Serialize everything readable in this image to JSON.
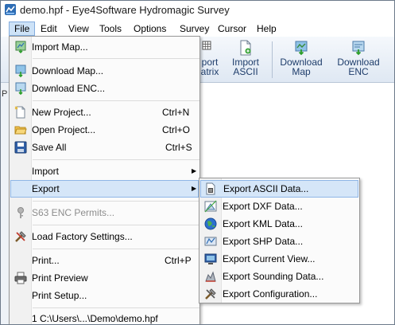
{
  "window": {
    "title": "demo.hpf - Eye4Software Hydromagic Survey"
  },
  "menubar": {
    "items": [
      "File",
      "Edit",
      "View",
      "Tools",
      "Options",
      "Survey",
      "Cursor",
      "Help"
    ]
  },
  "toolbar": {
    "buttons": [
      {
        "line1": "port",
        "line2": "atrix"
      },
      {
        "line1": "Import",
        "line2": "ASCII"
      },
      {
        "line1": "Download",
        "line2": "Map"
      },
      {
        "line1": "Download",
        "line2": "ENC"
      }
    ]
  },
  "left_panel": {
    "tab": "P"
  },
  "file_menu": {
    "items": [
      {
        "label": "Import Map...",
        "shortcut": "",
        "icon": "import-map-icon"
      },
      {
        "label": "Download Map...",
        "shortcut": "",
        "icon": "download-map-icon"
      },
      {
        "label": "Download ENC...",
        "shortcut": "",
        "icon": "download-enc-icon"
      },
      {
        "label": "New Project...",
        "shortcut": "Ctrl+N",
        "icon": "new-project-icon"
      },
      {
        "label": "Open Project...",
        "shortcut": "Ctrl+O",
        "icon": "open-folder-icon"
      },
      {
        "label": "Save All",
        "shortcut": "Ctrl+S",
        "icon": "save-disk-icon"
      },
      {
        "label": "Import",
        "shortcut": "",
        "icon": ""
      },
      {
        "label": "Export",
        "shortcut": "",
        "icon": ""
      },
      {
        "label": "S63 ENC Permits...",
        "shortcut": "",
        "icon": "key-icon"
      },
      {
        "label": "Load Factory Settings...",
        "shortcut": "",
        "icon": "tools-icon"
      },
      {
        "label": "Print...",
        "shortcut": "Ctrl+P",
        "icon": ""
      },
      {
        "label": "Print Preview",
        "shortcut": "",
        "icon": "printer-icon"
      },
      {
        "label": "Print Setup...",
        "shortcut": "",
        "icon": ""
      },
      {
        "label": "1 C:\\Users\\...\\Demo\\demo.hpf",
        "shortcut": "",
        "icon": ""
      }
    ]
  },
  "export_menu": {
    "items": [
      {
        "label": "Export ASCII Data...",
        "icon": "export-ascii-icon"
      },
      {
        "label": "Export DXF Data...",
        "icon": "export-dxf-icon"
      },
      {
        "label": "Export KML Data...",
        "icon": "export-kml-globe-icon"
      },
      {
        "label": "Export SHP Data...",
        "icon": "export-shp-icon"
      },
      {
        "label": "Export Current View...",
        "icon": "export-view-icon"
      },
      {
        "label": "Export Sounding Data...",
        "icon": "export-sounding-icon"
      },
      {
        "label": "Export Configuration...",
        "icon": "export-config-icon"
      }
    ]
  },
  "colors": {
    "highlight_bg": "#d5e6f8",
    "highlight_border": "#8fb6e6",
    "menu_active_bg": "#cde2f7",
    "toolbar_text": "#1e3d6b"
  }
}
